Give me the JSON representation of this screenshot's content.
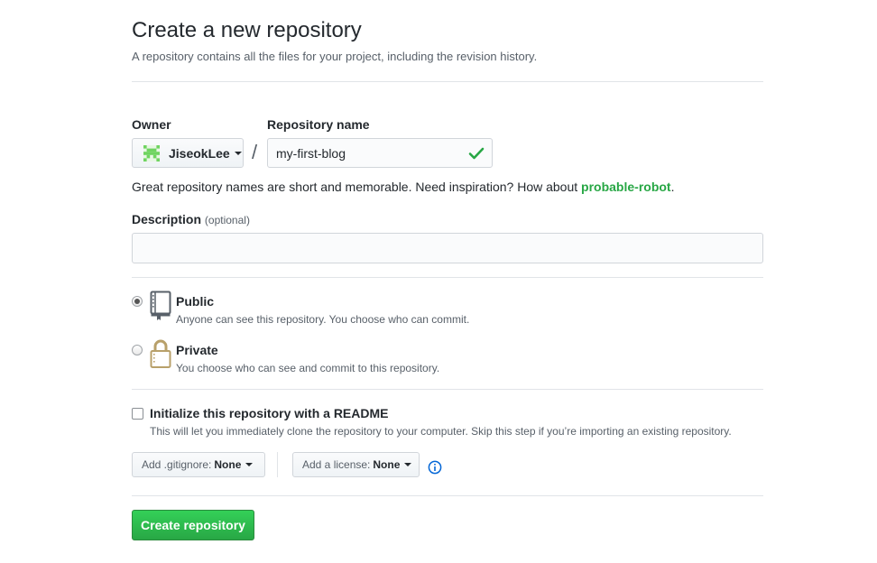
{
  "header": {
    "title": "Create a new repository",
    "subtitle": "A repository contains all the files for your project, including the revision history."
  },
  "owner": {
    "label": "Owner",
    "value": "JiseokLee"
  },
  "repo_name": {
    "label": "Repository name",
    "value": "my-first-blog",
    "separator": "/"
  },
  "hint": {
    "text": "Great repository names are short and memorable. Need inspiration? How about ",
    "suggestion": "probable-robot",
    "end": "."
  },
  "description": {
    "label": "Description",
    "optional": "(optional)",
    "value": ""
  },
  "visibility": {
    "public": {
      "label": "Public",
      "note": "Anyone can see this repository. You choose who can commit.",
      "selected": true
    },
    "private": {
      "label": "Private",
      "note": "You choose who can see and commit to this repository.",
      "selected": false
    }
  },
  "readme": {
    "label": "Initialize this repository with a README",
    "note": "This will let you immediately clone the repository to your computer. Skip this step if you’re importing an existing repository.",
    "checked": false
  },
  "gitignore": {
    "label": "Add .gitignore:",
    "value": "None"
  },
  "license": {
    "label": "Add a license:",
    "value": "None"
  },
  "create_button": {
    "label": "Create repository"
  },
  "icons": {
    "avatar": "identicon-avatar",
    "check": "check-icon",
    "public": "repo-book-icon",
    "private": "lock-icon",
    "info": "info-icon"
  },
  "colors": {
    "accent_green": "#28a745",
    "info_blue": "#0366d6",
    "private_gold": "#b8a06a"
  }
}
